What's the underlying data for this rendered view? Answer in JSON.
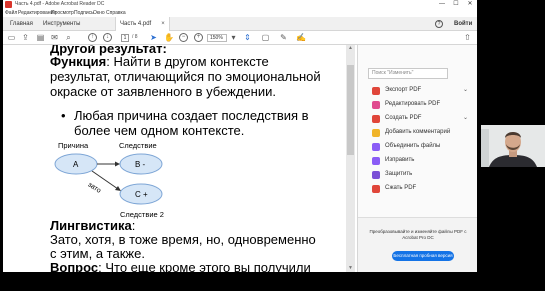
{
  "window": {
    "title": "Часть 4.pdf - Adobe Acrobat Reader DC",
    "minimize": "—",
    "maximize": "☐",
    "close": "✕"
  },
  "menu": [
    "Файл",
    "Редактирование",
    "Просмотр",
    "Подпись",
    "Окно",
    "Справка"
  ],
  "tabs": {
    "home": "Главная",
    "tools": "Инструменты",
    "document": "Часть 4.pdf",
    "help": "?",
    "signin": "Войти"
  },
  "toolbar": {
    "page_current": "1",
    "page_total": "/ 8",
    "zoom": "150%"
  },
  "document": {
    "heading_partial": "Другой результат:",
    "function_label": "Функция",
    "function_text": ": Найти в другом контексте",
    "line2": "результат, отличающийся по эмоциональной",
    "line3": "окраске от заявленного в убеждении.",
    "bullet_line1": "Любая причина создает последствия в",
    "bullet_line2": "более чем одном контексте.",
    "diagram": {
      "label_cause": "Причина",
      "label_effect": "Следствие",
      "node_a": "A",
      "node_b": "B -",
      "node_c": "C +",
      "edge_label": "зато",
      "label_effect2": "Следствие 2"
    },
    "linguistics_label": "Лингвистика",
    "linguistics_colon": ":",
    "ling_line1": "Зато, хотя, в тоже время, но, одновременно",
    "ling_line2": "с этим, а также.",
    "question_label": "Вопрос",
    "question_text": ": Что еще кроме этого вы получили"
  },
  "right_pane": {
    "search_placeholder": "Поиск \"Изменить\"",
    "tools": [
      {
        "label": "Экспорт PDF",
        "icon": "export-pdf-icon",
        "color": "#e0463a",
        "chevron": "⌄"
      },
      {
        "label": "Редактировать PDF",
        "icon": "edit-pdf-icon",
        "color": "#e04a8f",
        "chevron": ""
      },
      {
        "label": "Создать PDF",
        "icon": "create-pdf-icon",
        "color": "#e0463a",
        "chevron": "⌄"
      },
      {
        "label": "Добавить комментарий",
        "icon": "comment-icon",
        "color": "#f0b429",
        "chevron": ""
      },
      {
        "label": "Объединить файлы",
        "icon": "combine-files-icon",
        "color": "#8a5cf6",
        "chevron": ""
      },
      {
        "label": "Изправить",
        "icon": "fill-sign-icon",
        "color": "#8a5cf6",
        "chevron": ""
      },
      {
        "label": "Защитить",
        "icon": "protect-icon",
        "color": "#7a4fd6",
        "chevron": ""
      },
      {
        "label": "Сжать PDF",
        "icon": "compress-icon",
        "color": "#e0463a",
        "chevron": ""
      }
    ],
    "promo_text": "Преобразовывайте и изменяйте файлы PDF с Acrobat Pro DC",
    "promo_button": "Бесплатная пробная версия"
  }
}
